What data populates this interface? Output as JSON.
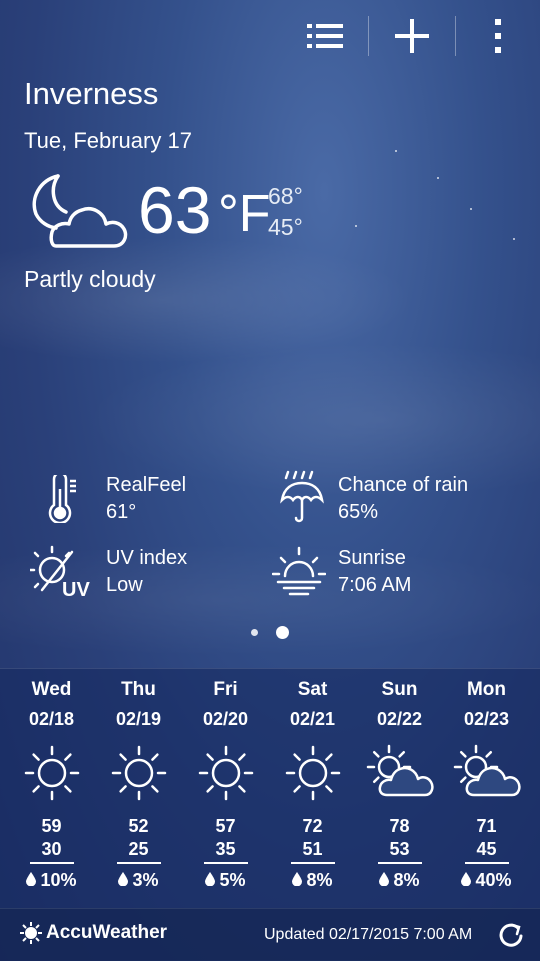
{
  "toolbar": {
    "list_icon": "list-icon",
    "add_icon": "plus-icon",
    "more_icon": "more-vertical-icon"
  },
  "location": {
    "city": "Inverness",
    "date": "Tue, February 17"
  },
  "current": {
    "icon": "moon-cloud-icon",
    "temperature": "63",
    "unit": "°F",
    "high": "68°",
    "low": "45°",
    "condition": "Partly cloudy"
  },
  "details": {
    "realfeel": {
      "label": "RealFeel",
      "value": "61°",
      "icon": "thermometer-icon"
    },
    "rain": {
      "label": "Chance of rain",
      "value": "65%",
      "icon": "umbrella-rain-icon"
    },
    "uv": {
      "label": "UV index",
      "value": "Low",
      "icon": "uv-sun-icon"
    },
    "sunrise": {
      "label": "Sunrise",
      "value": "7:06 AM",
      "icon": "sunrise-icon"
    }
  },
  "pager": {
    "pages": 2,
    "active": 2
  },
  "forecast": [
    {
      "day": "Wed",
      "date": "02/18",
      "icon": "sun-icon",
      "high": "59",
      "low": "30",
      "rain": "10%"
    },
    {
      "day": "Thu",
      "date": "02/19",
      "icon": "sun-icon",
      "high": "52",
      "low": "25",
      "rain": "3%"
    },
    {
      "day": "Fri",
      "date": "02/20",
      "icon": "sun-icon",
      "high": "57",
      "low": "35",
      "rain": "5%"
    },
    {
      "day": "Sat",
      "date": "02/21",
      "icon": "sun-icon",
      "high": "72",
      "low": "51",
      "rain": "8%"
    },
    {
      "day": "Sun",
      "date": "02/22",
      "icon": "sun-cloud-icon",
      "high": "78",
      "low": "53",
      "rain": "8%"
    },
    {
      "day": "Mon",
      "date": "02/23",
      "icon": "sun-cloud-icon",
      "high": "71",
      "low": "45",
      "rain": "40%"
    }
  ],
  "footer": {
    "brand": "AccuWeather",
    "updated": "Updated 02/17/2015 7:00 AM"
  }
}
